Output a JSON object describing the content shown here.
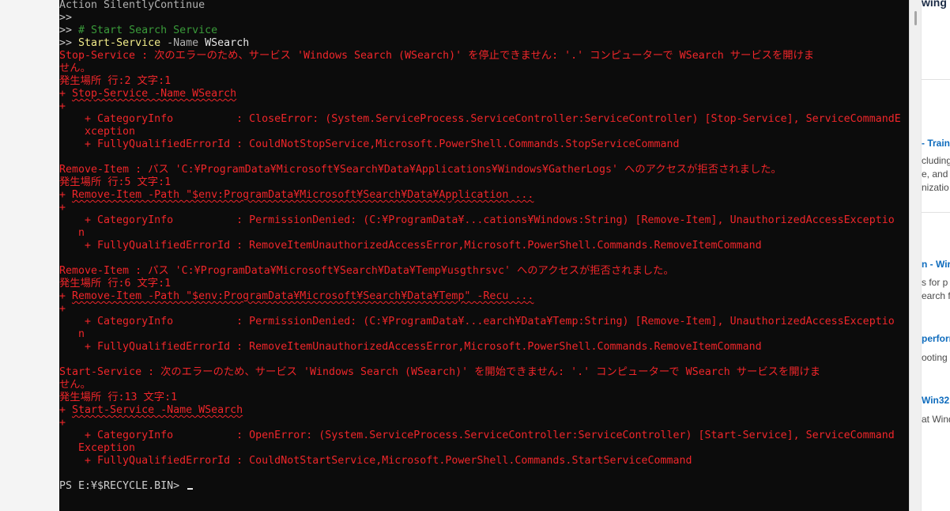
{
  "terminal": {
    "lines": [
      [
        {
          "t": "Action SilentlyContinue",
          "c": "#b0b0b0"
        }
      ],
      [
        {
          "t": ">>",
          "c": "#c8c8c8"
        }
      ],
      [
        {
          "t": ">> ",
          "c": "#c8c8c8"
        },
        {
          "t": "# Start Search Service",
          "c": "#3a9b3a"
        }
      ],
      [
        {
          "t": ">> ",
          "c": "#c8c8c8"
        },
        {
          "t": "Start-Service",
          "c": "#f2ec8a"
        },
        {
          "t": " -Name",
          "c": "#b0b0b0"
        },
        {
          "t": " WSearch",
          "c": "#e6e6e6"
        }
      ],
      [
        {
          "t": "Stop-Service : 次のエラーのため、サービス 'Windows Search (WSearch)' を停止できません: '.' コンピューターで WSearch サービスを開けま",
          "c": "#f0262a"
        }
      ],
      [
        {
          "t": "せん。",
          "c": "#f0262a"
        }
      ],
      [
        {
          "t": "発生場所 行:2 文字:1",
          "c": "#f0262a"
        }
      ],
      [
        {
          "t": "+ ",
          "c": "#f0262a"
        },
        {
          "t": "Stop-Service -Name WSearch",
          "c": "#f0262a",
          "u": true
        }
      ],
      [
        {
          "t": "+",
          "c": "#f0262a"
        }
      ],
      [
        {
          "t": "    + CategoryInfo          : CloseError: (System.ServiceProcess.ServiceController:ServiceController) [Stop-Service], ServiceCommandE",
          "c": "#f0262a"
        }
      ],
      [
        {
          "t": "    xception",
          "c": "#f0262a"
        }
      ],
      [
        {
          "t": "    + FullyQualifiedErrorId : CouldNotStopService,Microsoft.PowerShell.Commands.StopServiceCommand",
          "c": "#f0262a"
        }
      ],
      [],
      [
        {
          "t": "Remove-Item : パス 'C:¥ProgramData¥Microsoft¥Search¥Data¥Applications¥Windows¥GatherLogs' へのアクセスが拒否されました。",
          "c": "#f0262a"
        }
      ],
      [
        {
          "t": "発生場所 行:5 文字:1",
          "c": "#f0262a"
        }
      ],
      [
        {
          "t": "+ ",
          "c": "#f0262a"
        },
        {
          "t": "Remove-Item -Path \"$env:ProgramData¥Microsoft¥Search¥Data¥Application ...",
          "c": "#f0262a",
          "u": true
        }
      ],
      [
        {
          "t": "+",
          "c": "#f0262a"
        }
      ],
      [
        {
          "t": "    + CategoryInfo          : PermissionDenied: (C:¥ProgramData¥...cations¥Windows:String) [Remove-Item], UnauthorizedAccessExceptio",
          "c": "#f0262a"
        }
      ],
      [
        {
          "t": "   n",
          "c": "#f0262a"
        }
      ],
      [
        {
          "t": "    + FullyQualifiedErrorId : RemoveItemUnauthorizedAccessError,Microsoft.PowerShell.Commands.RemoveItemCommand",
          "c": "#f0262a"
        }
      ],
      [],
      [
        {
          "t": "Remove-Item : パス 'C:¥ProgramData¥Microsoft¥Search¥Data¥Temp¥usgthrsvc' へのアクセスが拒否されました。",
          "c": "#f0262a"
        }
      ],
      [
        {
          "t": "発生場所 行:6 文字:1",
          "c": "#f0262a"
        }
      ],
      [
        {
          "t": "+ ",
          "c": "#f0262a"
        },
        {
          "t": "Remove-Item -Path \"$env:ProgramData¥Microsoft¥Search¥Data¥Temp\" -Recu ...",
          "c": "#f0262a",
          "u": true
        }
      ],
      [
        {
          "t": "+",
          "c": "#f0262a"
        }
      ],
      [
        {
          "t": "    + CategoryInfo          : PermissionDenied: (C:¥ProgramData¥...earch¥Data¥Temp:String) [Remove-Item], UnauthorizedAccessExceptio",
          "c": "#f0262a"
        }
      ],
      [
        {
          "t": "   n",
          "c": "#f0262a"
        }
      ],
      [
        {
          "t": "    + FullyQualifiedErrorId : RemoveItemUnauthorizedAccessError,Microsoft.PowerShell.Commands.RemoveItemCommand",
          "c": "#f0262a"
        }
      ],
      [],
      [
        {
          "t": "Start-Service : 次のエラーのため、サービス 'Windows Search (WSearch)' を開始できません: '.' コンピューターで WSearch サービスを開けま",
          "c": "#f0262a"
        }
      ],
      [
        {
          "t": "せん。",
          "c": "#f0262a"
        }
      ],
      [
        {
          "t": "発生場所 行:13 文字:1",
          "c": "#f0262a"
        }
      ],
      [
        {
          "t": "+ ",
          "c": "#f0262a"
        },
        {
          "t": "Start-Service -Name WSearch",
          "c": "#f0262a",
          "u": true
        }
      ],
      [
        {
          "t": "+",
          "c": "#f0262a"
        }
      ],
      [
        {
          "t": "    + CategoryInfo          : OpenError: (System.ServiceProcess.ServiceController:ServiceController) [Start-Service], ServiceCommand",
          "c": "#f0262a"
        }
      ],
      [
        {
          "t": "   Exception",
          "c": "#f0262a"
        }
      ],
      [
        {
          "t": "    + FullyQualifiedErrorId : CouldNotStartService,Microsoft.PowerShell.Commands.StartServiceCommand",
          "c": "#f0262a"
        }
      ],
      []
    ],
    "prompt": "PS E:¥$RECYCLE.BIN> "
  },
  "side_panel": {
    "header": "wing",
    "items": [
      "- Train",
      "cluding",
      "e, and",
      "nizatio",
      "n - Wir",
      "s for p",
      "earch f",
      "perforr",
      "ooting",
      "Win32",
      "at Wind"
    ]
  }
}
